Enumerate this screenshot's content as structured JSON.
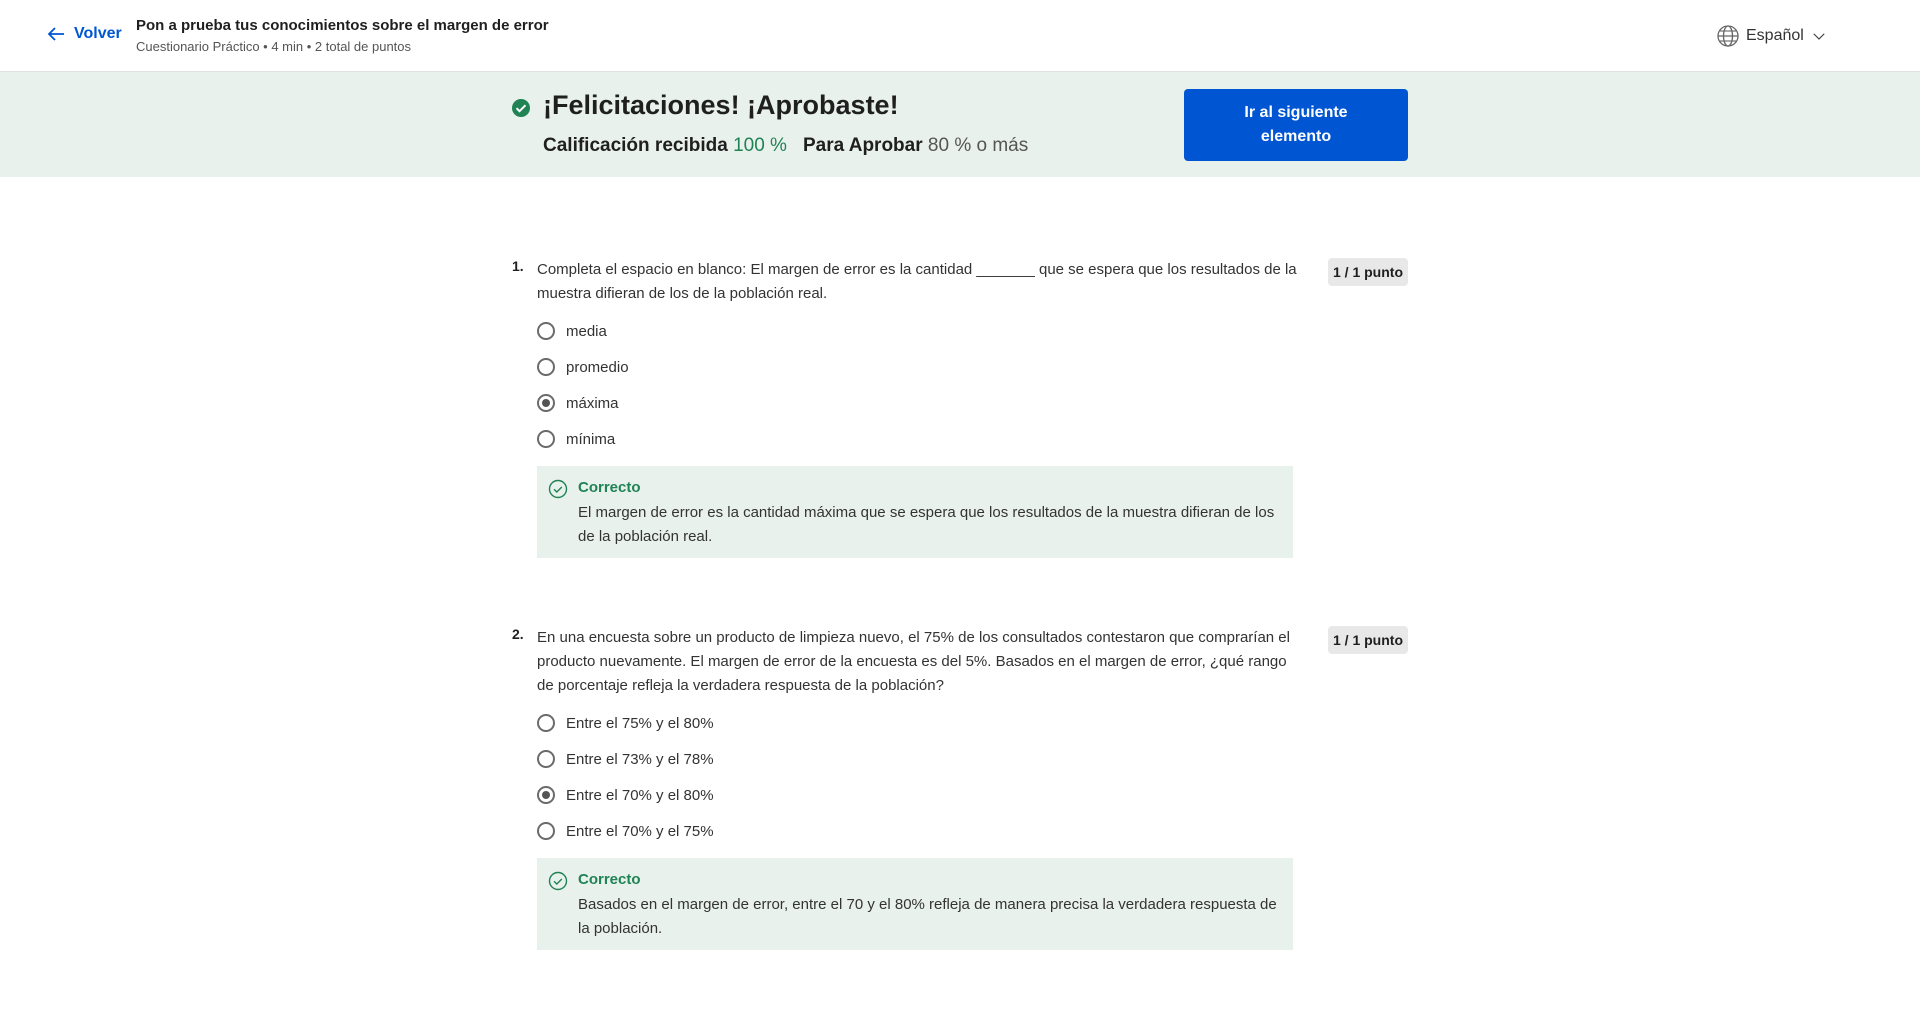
{
  "header": {
    "back_label": "Volver",
    "title": "Pon a prueba tus conocimientos sobre el margen de error",
    "subtitle": "Cuestionario Práctico • 4 min • 2 total de puntos",
    "language": "Español"
  },
  "banner": {
    "heading": "¡Felicitaciones! ¡Aprobaste!",
    "grade_label": "Calificación recibida",
    "grade_value": "100 %",
    "pass_label": "Para Aprobar",
    "pass_value": "80 % o más",
    "next_button": "Ir al siguiente elemento"
  },
  "questions": [
    {
      "number": "1.",
      "text": "Completa el espacio en blanco: El margen de error es la cantidad _______ que se espera que los resultados de la muestra difieran de los de la población real.",
      "points": "1 / 1 punto",
      "options": [
        "media",
        "promedio",
        "máxima",
        "mínima"
      ],
      "selected": 2,
      "feedback_title": "Correcto",
      "feedback_text": "El margen de error es la cantidad máxima que se espera que los resultados de la muestra difieran de los de la población real."
    },
    {
      "number": "2.",
      "text": "En una encuesta sobre un producto de limpieza nuevo, el 75% de los consultados contestaron que comprarían el producto nuevamente. El margen de error de la encuesta es del 5%. Basados en el margen de error, ¿qué rango de porcentaje refleja la verdadera respuesta de la población?",
      "points": "1 / 1 punto",
      "options": [
        "Entre el 75% y el 80%",
        "Entre el 73% y el 78%",
        "Entre el 70% y el 80%",
        "Entre el 70% y el 75%"
      ],
      "selected": 2,
      "feedback_title": "Correcto",
      "feedback_text": "Basados en el margen de error, entre el 70 y el 80% refleja de manera precisa la verdadera respuesta de la población."
    }
  ],
  "colors": {
    "accent": "#0056d2",
    "success": "#1f8354",
    "banner_bg": "#e9f1ed"
  }
}
